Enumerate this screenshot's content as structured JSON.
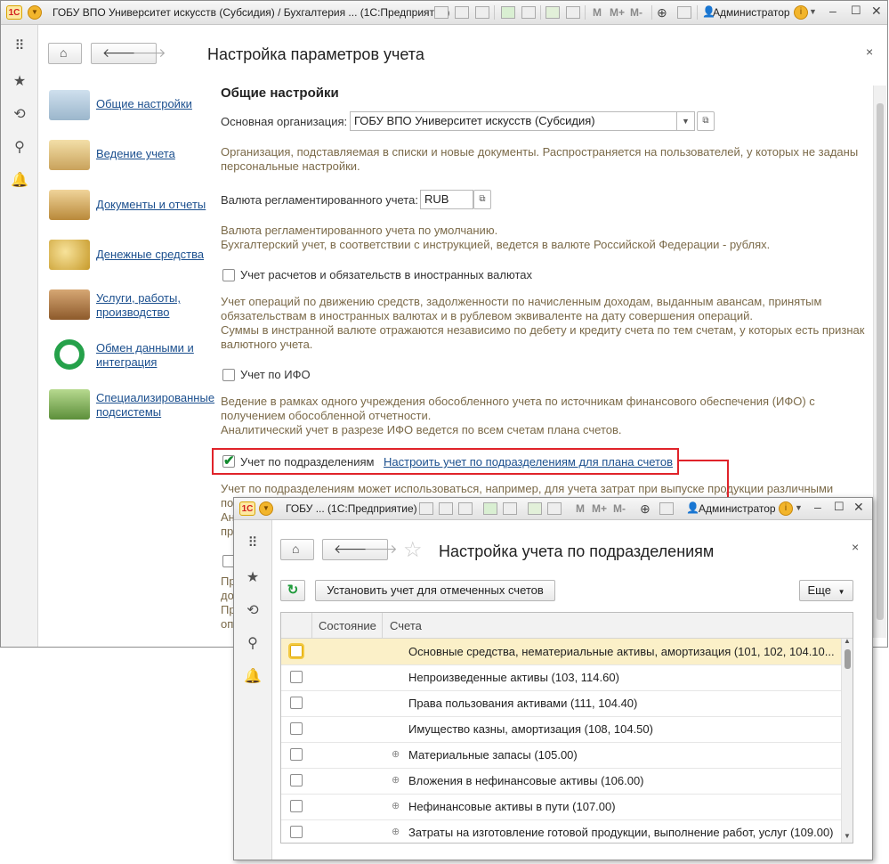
{
  "main_window": {
    "title": "ГОБУ ВПО Университет искусств (Субсидия) / Бухгалтерия ...  (1С:Предприятие)",
    "user": "Администратор",
    "toolbar_marks": [
      "M",
      "M+",
      "M-"
    ],
    "page_title": "Настройка параметров учета",
    "nav": [
      {
        "label": "Общие настройки"
      },
      {
        "label": "Ведение учета"
      },
      {
        "label": "Документы и отчеты"
      },
      {
        "label": "Денежные средства"
      },
      {
        "label": "Услуги, работы, производство"
      },
      {
        "label": "Обмен данными и интеграция"
      },
      {
        "label": "Специализированные подсистемы"
      }
    ],
    "section_title": "Общие настройки",
    "org_label": "Основная организация:",
    "org_value": "ГОБУ ВПО Университет искусств (Субсидия)",
    "org_desc": "Организация, подставляемая в списки и новые документы. Распространяется на пользователей, у которых не заданы персональные настройки.",
    "currency_label": "Валюта регламентированного учета:",
    "currency_value": "RUB",
    "currency_desc_1": "Валюта регламентированного учета по умолчанию.",
    "currency_desc_2": "Бухгалтерский учет, в соответствии с инструкцией, ведется в валюте Российской Федерации - рублях.",
    "foreign_label": "Учет расчетов и обязательств в иностранных валютах",
    "foreign_checked": false,
    "foreign_desc_1": "Учет операций по движению средств, задолженности по начисленным доходам, выданным авансам, принятым обязательствам в иностранных валютах и в рублевом эквиваленте на дату совершения операций.",
    "foreign_desc_2": "Суммы в инстранной валюте отражаются независимо по дебету и кредиту счета по тем счетам, у которых есть признак валютного учета.",
    "ifo_label": "Учет по ИФО",
    "ifo_checked": false,
    "ifo_desc_1": "Ведение в рамках одного учреждения обособленного учета по источникам финансового обеспечения (ИФО) с получением обособленной отчетности.",
    "ifo_desc_2": "Аналитический учет в разрезе ИФО ведется по всем счетам плана счетов.",
    "dept_label": "Учет по подразделениям",
    "dept_checked": true,
    "dept_link": "Настроить учет по подразделениям для плана счетов",
    "dept_desc_1": "Учет по подразделениям может использоваться, например, для учета затрат при выпуске продукции различными",
    "partial": {
      "a": "по",
      "b": "Ан",
      "c": "пр",
      "d": "Пр",
      "e": "до",
      "f": "Пр",
      "g": "оп"
    }
  },
  "popup_window": {
    "title": "ГОБУ ...  (1С:Предприятие)",
    "user": "Администратор",
    "toolbar_marks": [
      "M",
      "M+",
      "M-"
    ],
    "page_title": "Настройка учета по подразделениям",
    "set_button": "Установить учет для отмеченных счетов",
    "more_button": "Еще",
    "columns": [
      "Состояние",
      "Счета"
    ],
    "rows": [
      {
        "account": "Основные средства, нематериальные активы, амортизация (101, 102, 104.10...",
        "expandable": false,
        "selected": true
      },
      {
        "account": "Непроизведенные активы (103, 114.60)",
        "expandable": false,
        "selected": false
      },
      {
        "account": "Права пользования активами (111, 104.40)",
        "expandable": false,
        "selected": false
      },
      {
        "account": "Имущество казны, амортизация (108, 104.50)",
        "expandable": false,
        "selected": false
      },
      {
        "account": "Материальные запасы (105.00)",
        "expandable": true,
        "selected": false
      },
      {
        "account": "Вложения в нефинансовые активы (106.00)",
        "expandable": true,
        "selected": false
      },
      {
        "account": "Нефинансовые активы в пути (107.00)",
        "expandable": true,
        "selected": false
      },
      {
        "account": "Затраты на изготовление готовой продукции, выполнение работ, услуг (109.00)",
        "expandable": true,
        "selected": false
      }
    ]
  },
  "colors": {
    "highlight": "#e0232a",
    "link": "#1b4f8e",
    "desc": "#7b6a49",
    "selected_row": "#fbf0c8"
  }
}
